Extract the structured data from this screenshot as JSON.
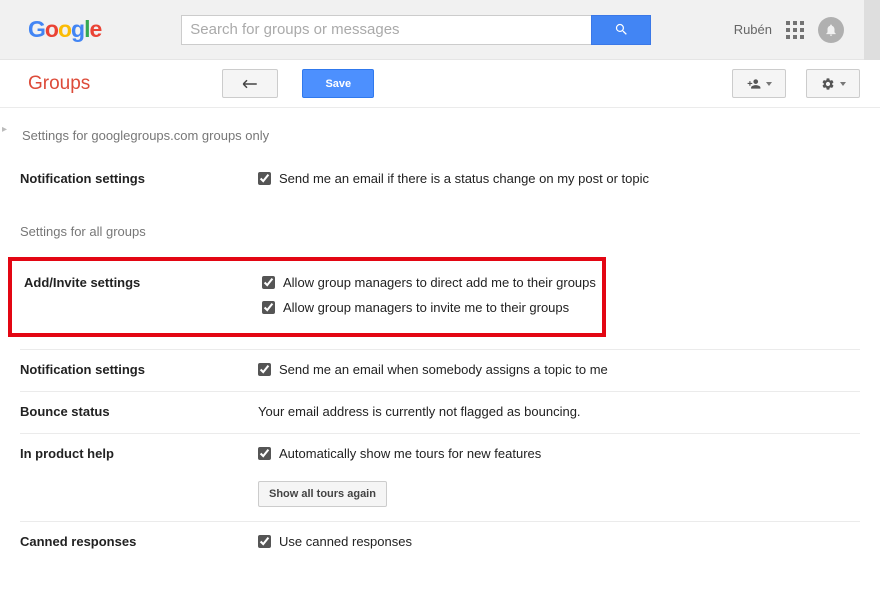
{
  "header": {
    "search_placeholder": "Search for groups or messages",
    "username": "Rubén"
  },
  "toolbar": {
    "app_title": "Groups",
    "save_label": "Save"
  },
  "content": {
    "gg_note": "Settings for googlegroups.com groups only",
    "notif1_label": "Notification settings",
    "notif1_check": "Send me an email if there is a status change on my post or topic",
    "all_groups_header": "Settings for all groups",
    "addinvite_label": "Add/Invite settings",
    "addinvite_c1": "Allow group managers to direct add me to their groups",
    "addinvite_c2": "Allow group managers to invite me to their groups",
    "notif2_label": "Notification settings",
    "notif2_check": "Send me an email when somebody assigns a topic to me",
    "bounce_label": "Bounce status",
    "bounce_text": "Your email address is currently not flagged as bouncing.",
    "help_label": "In product help",
    "help_check": "Automatically show me tours for new features",
    "help_btn": "Show all tours again",
    "canned_label": "Canned responses",
    "canned_check": "Use canned responses"
  }
}
